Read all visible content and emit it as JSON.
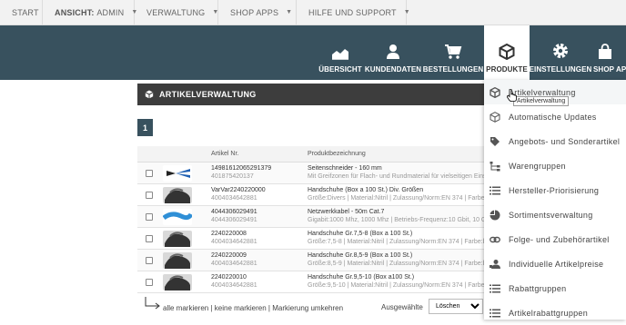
{
  "topbar": {
    "start": "START",
    "ansicht_prefix": "ANSICHT:",
    "ansicht_value": "ADMIN",
    "verwaltung": "VERWALTUNG",
    "shop_apps": "SHOP APPS",
    "hilfe": "HILFE UND SUPPORT"
  },
  "nav": {
    "uebersicht": "ÜBERSICHT",
    "kundendaten": "KUNDENDATEN",
    "bestellungen": "BESTELLUNGEN",
    "produkte": "PRODUKTE",
    "einstellungen": "EINSTELLUNGEN",
    "shop_apps": "SHOP AP"
  },
  "panel": {
    "title": "ARTIKELVERWALTUNG",
    "page": "1"
  },
  "table": {
    "headers": [
      "",
      "",
      "Artikel Nr.",
      "Produktbezeichnung"
    ],
    "rows": [
      {
        "nr": "14981612065291379",
        "nr2": "401875420137",
        "name": "Seitenschneider - 160 mm",
        "desc": "Mit Greifzonen für Flach- und Rundmaterial für vielseitigen Einsa"
      },
      {
        "nr": "VarVar2240220000",
        "nr2": "4004034642881",
        "name": "Handschuhe (Box a 100 St.) Div. Größen",
        "desc": "Größe:Divers | Material:Nitril | Zulassung/Norm:EN 374 | Farbe:b"
      },
      {
        "nr": "4044306029491",
        "nr2": "4044306029491",
        "name": "Netzwerkkabel - 50m Cat.7",
        "desc": "Gigabit:1000 Mhz, 1000 Mhz | Betriebs-Frequenz:10 Gbit, 10 Gbi"
      },
      {
        "nr": "2240220008",
        "nr2": "4004034642881",
        "name": "Handschuhe Gr.7,5-8 (Box a 100 St.)",
        "desc": "Größe:7,5-8 | Material:Nitril | Zulassung/Norm:EN 374 | Farbe:bl"
      },
      {
        "nr": "2240220009",
        "nr2": "4004034642881",
        "name": "Handschuhe Gr.8,5-9 (Box a 100 St.)",
        "desc": "Größe:8,5-9 | Material:Nitril | Zulassung/Norm:EN 374 | Farbe:bl"
      },
      {
        "nr": "2240220010",
        "nr2": "4004034642881",
        "name": "Handschuhe Gr.9,5-10 (Box a100 St.)",
        "desc": "Größe:9,5-10 | Material:Nitril | Zulassung/Norm:EN 374 | Farbe:b"
      }
    ]
  },
  "footer": {
    "alle": "alle markieren",
    "sep1": " | ",
    "keine": "keine markieren",
    "sep2": " | ",
    "umkehren": "Markierung umkehren",
    "ausgewaehlte": "Ausgewählte",
    "action": "Löschen"
  },
  "menu": {
    "items": [
      "Artikelverwaltung",
      "Automatische Updates",
      "Angebots- und Sonderartikel",
      "Warengruppen",
      "Hersteller-Priorisierung",
      "Sortimentsverwaltung",
      "Folge- und Zubehörartikel",
      "Individuelle Artikelpreise",
      "Rabattgruppen",
      "Artikelrabattgruppen"
    ],
    "tooltip": "Artikelverwaltung"
  },
  "colors": {
    "nav_bg": "#38515e",
    "panel_header": "#3d3d3d"
  }
}
